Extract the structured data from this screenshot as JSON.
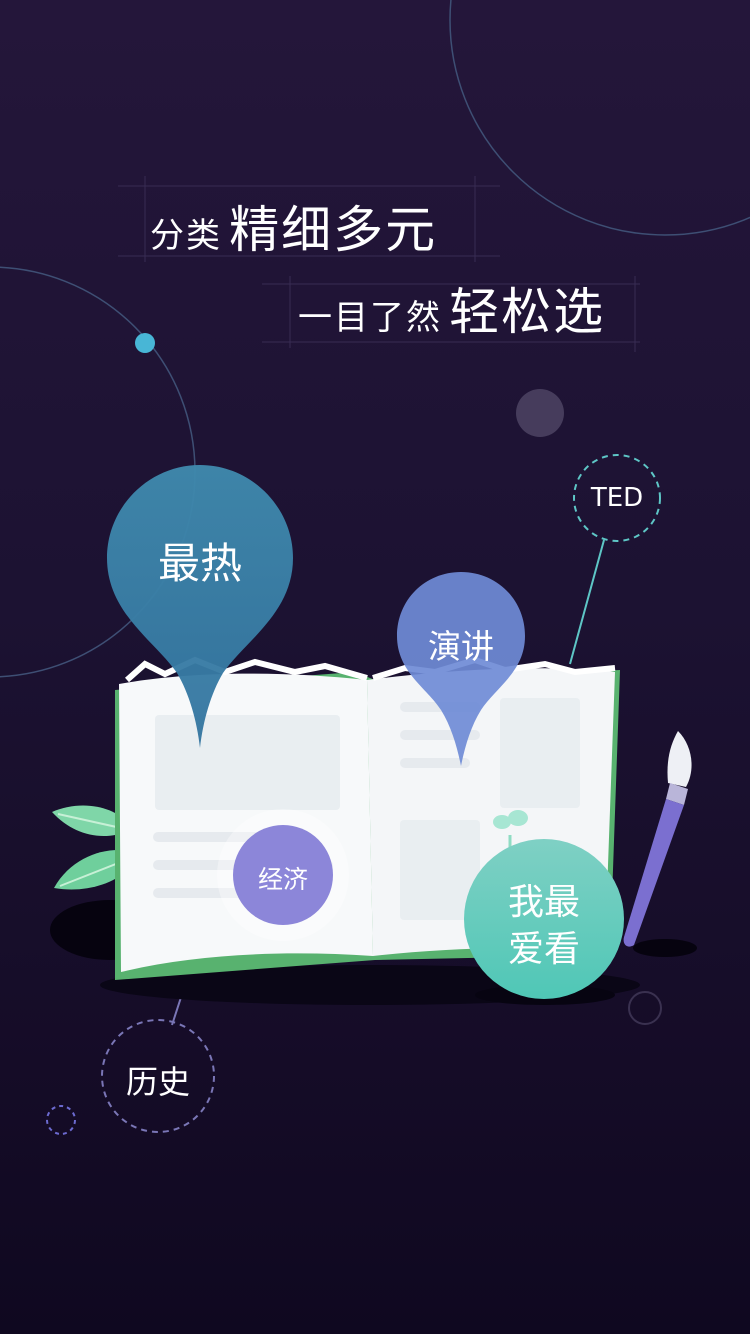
{
  "headline": {
    "line1_small": "分类",
    "line1_big": "精细多元",
    "line2_small": "一目了然",
    "line2_big": "轻松选"
  },
  "tags": {
    "hot": "最热",
    "speech": "演讲",
    "economy": "经济",
    "favorite_line1": "我最",
    "favorite_line2": "爱看",
    "ted": "TED",
    "history": "历史"
  },
  "colors": {
    "background": "#1c1232",
    "hot_pin": "#3a7ea0",
    "speech_pin": "#6f8bd6",
    "economy_circle": "#8c86d9",
    "favorite_circle": "#5ccbbf",
    "accent_dot": "#48b6d6"
  }
}
